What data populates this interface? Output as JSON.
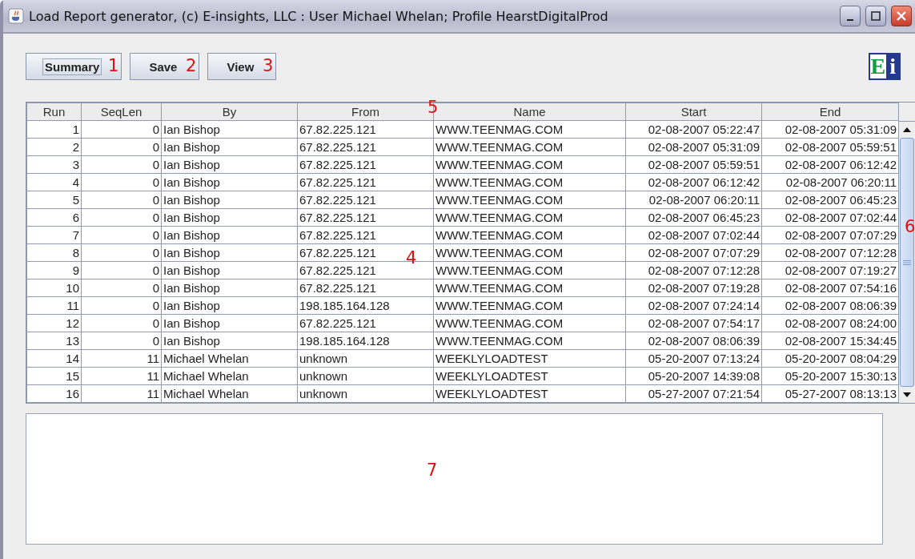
{
  "window": {
    "title": "Load Report generator, (c) E-insights, LLC : User  Michael Whelan; Profile HearstDigitalProd"
  },
  "toolbar": {
    "buttons": [
      {
        "label": "Summary",
        "focused": true,
        "callout": "1"
      },
      {
        "label": "Save",
        "focused": false,
        "callout": "2"
      },
      {
        "label": "View",
        "focused": false,
        "callout": "3"
      }
    ]
  },
  "logo": {
    "left": "E",
    "right": "i"
  },
  "table": {
    "columns": [
      "Run",
      "SeqLen",
      "By",
      "From",
      "Name",
      "Start",
      "End"
    ],
    "rows": [
      [
        "1",
        "0",
        "Ian Bishop",
        "67.82.225.121",
        "WWW.TEENMAG.COM",
        "02-08-2007 05:22:47",
        "02-08-2007 05:31:09"
      ],
      [
        "2",
        "0",
        "Ian Bishop",
        "67.82.225.121",
        "WWW.TEENMAG.COM",
        "02-08-2007 05:31:09",
        "02-08-2007 05:59:51"
      ],
      [
        "3",
        "0",
        "Ian Bishop",
        "67.82.225.121",
        "WWW.TEENMAG.COM",
        "02-08-2007 05:59:51",
        "02-08-2007 06:12:42"
      ],
      [
        "4",
        "0",
        "Ian Bishop",
        "67.82.225.121",
        "WWW.TEENMAG.COM",
        "02-08-2007 06:12:42",
        "02-08-2007 06:20:11"
      ],
      [
        "5",
        "0",
        "Ian Bishop",
        "67.82.225.121",
        "WWW.TEENMAG.COM",
        "02-08-2007 06:20:11",
        "02-08-2007 06:45:23"
      ],
      [
        "6",
        "0",
        "Ian Bishop",
        "67.82.225.121",
        "WWW.TEENMAG.COM",
        "02-08-2007 06:45:23",
        "02-08-2007 07:02:44"
      ],
      [
        "7",
        "0",
        "Ian Bishop",
        "67.82.225.121",
        "WWW.TEENMAG.COM",
        "02-08-2007 07:02:44",
        "02-08-2007 07:07:29"
      ],
      [
        "8",
        "0",
        "Ian Bishop",
        "67.82.225.121",
        "WWW.TEENMAG.COM",
        "02-08-2007 07:07:29",
        "02-08-2007 07:12:28"
      ],
      [
        "9",
        "0",
        "Ian Bishop",
        "67.82.225.121",
        "WWW.TEENMAG.COM",
        "02-08-2007 07:12:28",
        "02-08-2007 07:19:27"
      ],
      [
        "10",
        "0",
        "Ian Bishop",
        "67.82.225.121",
        "WWW.TEENMAG.COM",
        "02-08-2007 07:19:28",
        "02-08-2007 07:54:16"
      ],
      [
        "11",
        "0",
        "Ian Bishop",
        "198.185.164.128",
        "WWW.TEENMAG.COM",
        "02-08-2007 07:24:14",
        "02-08-2007 08:06:39"
      ],
      [
        "12",
        "0",
        "Ian Bishop",
        "67.82.225.121",
        "WWW.TEENMAG.COM",
        "02-08-2007 07:54:17",
        "02-08-2007 08:24:00"
      ],
      [
        "13",
        "0",
        "Ian Bishop",
        "198.185.164.128",
        "WWW.TEENMAG.COM",
        "02-08-2007 08:06:39",
        "02-08-2007 15:34:45"
      ],
      [
        "14",
        "11",
        "Michael Whelan",
        "unknown",
        "WEEKLYLOADTEST",
        "05-20-2007 07:13:24",
        "05-20-2007 08:04:29"
      ],
      [
        "15",
        "11",
        "Michael Whelan",
        "unknown",
        "WEEKLYLOADTEST",
        "05-20-2007 14:39:08",
        "05-20-2007 15:30:13"
      ],
      [
        "16",
        "11",
        "Michael Whelan",
        "unknown",
        "WEEKLYLOADTEST",
        "05-27-2007 07:21:54",
        "05-27-2007 08:13:13"
      ]
    ]
  },
  "annotations": [
    {
      "label": "5"
    },
    {
      "label": "4"
    },
    {
      "label": "6"
    },
    {
      "label": "7"
    }
  ]
}
